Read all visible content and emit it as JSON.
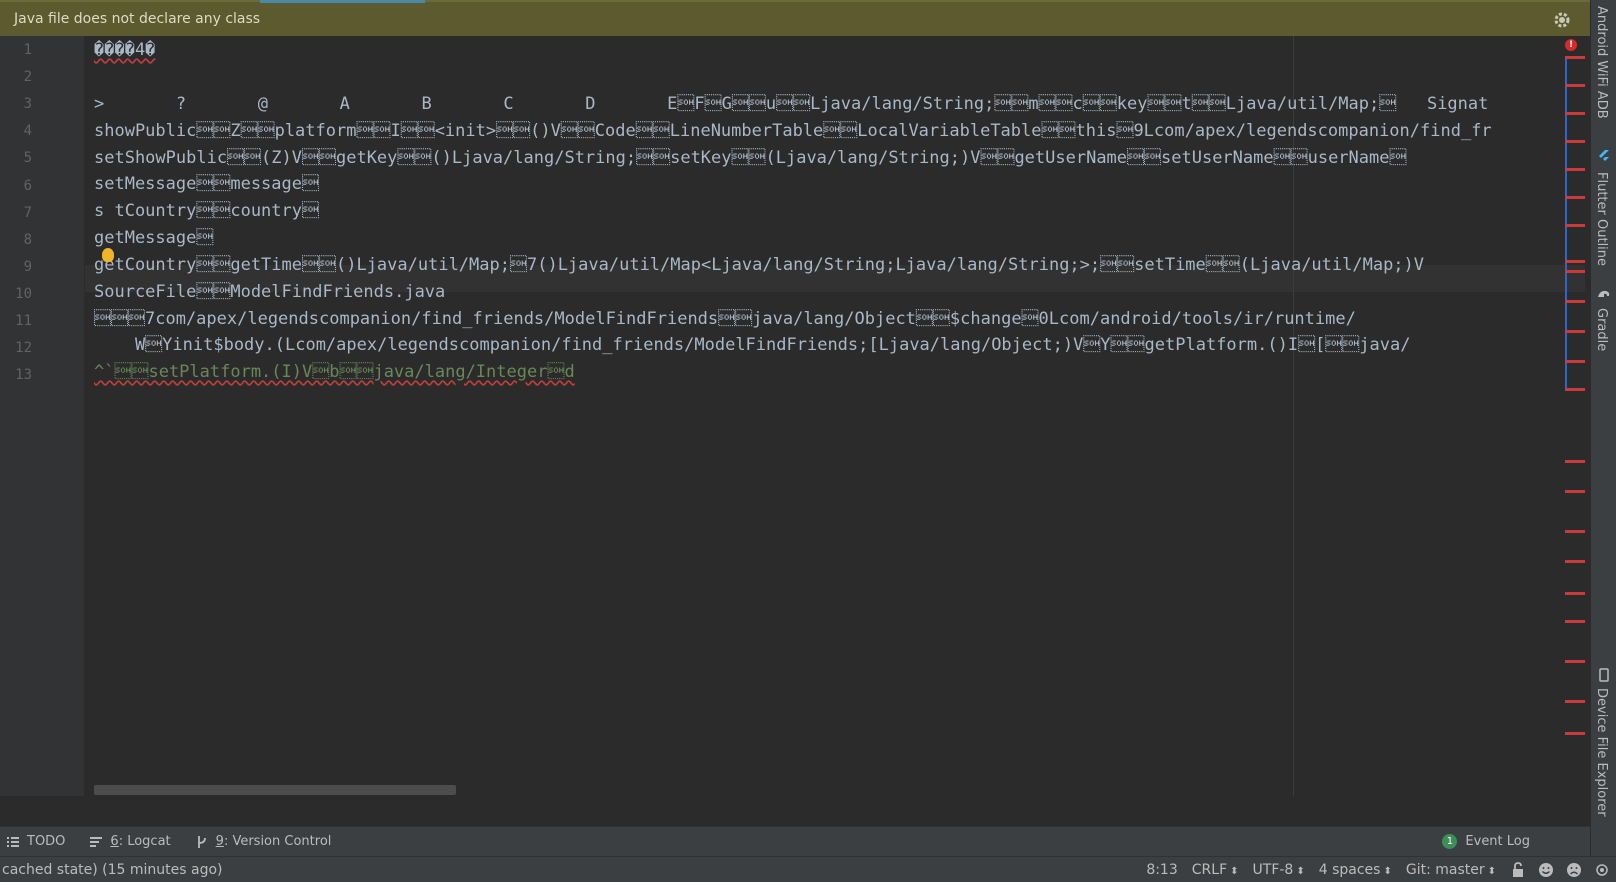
{
  "banner": {
    "message": "Java file does not declare any class"
  },
  "editor": {
    "line_numbers": [
      "1",
      "2",
      "3",
      "4",
      "5",
      "6",
      "7",
      "8",
      "9",
      "10",
      "11",
      "12",
      "13"
    ],
    "lines": [
      "����4�",
      "",
      ">       ?       @       A       B       C       D       E\u0001F\u0001G\u0001\u0001u\u0001\u0001Ljava/lang/String;\u0001\u0001m\u0001\u0001c\u0001\u0001key\u0001\u0001t\u0001\u0001Ljava/util/Map;\u0001   Signat",
      "showPublic\u0001\u0001Z\u0001\u0001platform\u0001\u0001I\u0001\u0001<init>\u0001\u0001()V\u0001\u0001Code\u0001\u0001LineNumberTable\u0001\u0001LocalVariableTable\u0001\u0001this\u00019Lcom/apex/legendscompanion/find_fr",
      "setShowPublic\u0001\u0001(Z)V\u0001\u0001getKey\u0001\u0001()Ljava/lang/String;\u0001\u0001setKey\u0001\u0001(Ljava/lang/String;)V\u0001\u0001getUserName\u0001\u0001setUserName\u0001\u0001userName\u0001",
      "setMessage\u0001\u0001message\u0001",
      "s tCountry\u0001\u0001country\u0001",
      "getMessage\u0001",
      "getCountry\u0001\u0001getTime\u0001\u0001()Ljava/util/Map;\u00017()Ljava/util/Map<Ljava/lang/String;Ljava/lang/String;>;\u0001\u0001setTime\u0001\u0001(Ljava/util/Map;)V",
      "SourceFile\u0001\u0001ModelFindFriends.java",
      "\u0001\u0001\u00017com/apex/legendscompanion/find_friends/ModelFindFriends\u0001\u0001java/lang/Object\u0001\u0001$change\u00010Lcom/android/tools/ir/runtime/",
      "    W\u0001Yinit$body.(Lcom/apex/legendscompanion/find_friends/ModelFindFriends;[Ljava/lang/Object;)V\u0001Y\u0001\u0001getPlatform.()I\u0001[\u0001\u0001java/",
      "^`\u0001\u0001setPlatform.(I)V\u0001b\u0001\u0001java/lang/Integer\u0001d"
    ]
  },
  "right_tools": {
    "wifi_adb": "Android WiFi ADB",
    "flutter_outline": "Flutter Outline",
    "gradle": "Gradle",
    "device_file_explorer": "Device File Explorer"
  },
  "tool_windows": {
    "todo": "TODO",
    "logcat_num": "6",
    "logcat": ": Logcat",
    "vcs_num": "9",
    "vcs": ": Version Control",
    "event_log": "Event Log",
    "event_log_count": "1"
  },
  "status": {
    "message": "cached state) (15 minutes ago)",
    "position": "8:13",
    "line_sep": "CRLF",
    "encoding": "UTF-8",
    "indent": "4 spaces",
    "git": "Git: master"
  },
  "colors": {
    "banner_bg": "#5d5a2f",
    "editor_bg": "#2b2b2b",
    "error_red": "#c93a3a"
  }
}
